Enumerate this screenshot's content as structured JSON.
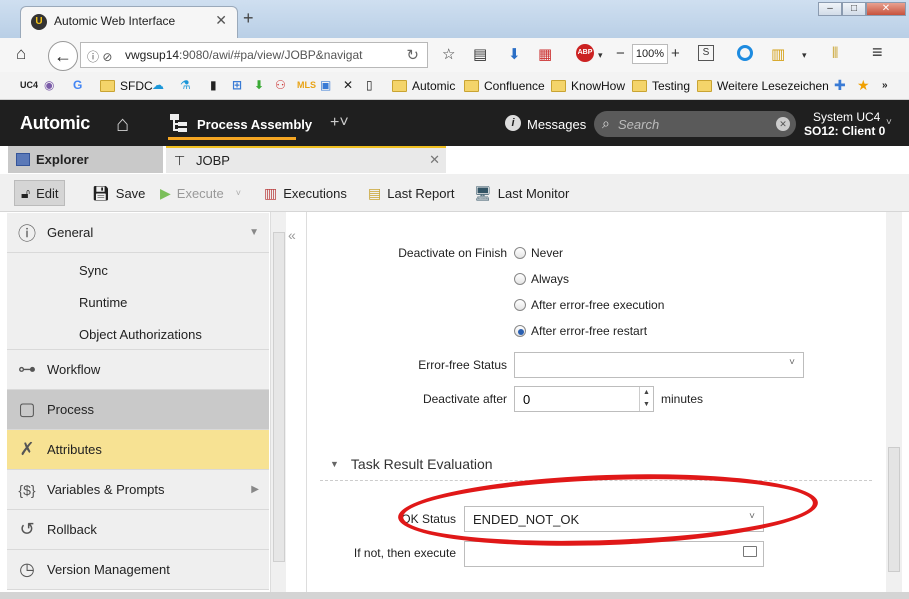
{
  "browser": {
    "tab_title": "Automic Web Interface",
    "url_host": "vwgsup14",
    "url_rest": ":9080/awi/#pa/view/JOBP&navigat",
    "zoom": "100%",
    "bookmarks": [
      "SFDC",
      "Automic",
      "Confluence",
      "KnowHow",
      "Testing",
      "Weitere Lesezeichen"
    ]
  },
  "app": {
    "logo": "Automic",
    "perspective": "Process Assembly",
    "messages": "Messages",
    "search_placeholder": "Search",
    "system": "System UC4",
    "client": "SO12: Client 0"
  },
  "tabs": {
    "explorer": "Explorer",
    "object": "JOBP"
  },
  "toolbar": {
    "edit": "Edit",
    "save": "Save",
    "execute": "Execute",
    "executions": "Executions",
    "last_report": "Last Report",
    "last_monitor": "Last Monitor"
  },
  "sidebar": {
    "general": "General",
    "general_sub": [
      "Sync",
      "Runtime",
      "Object Authorizations"
    ],
    "workflow": "Workflow",
    "process": "Process",
    "attributes": "Attributes",
    "variables": "Variables & Prompts",
    "rollback": "Rollback",
    "version": "Version Management"
  },
  "form": {
    "deactivate_label": "Deactivate on Finish",
    "deactivate_options": [
      "Never",
      "Always",
      "After error-free execution",
      "After error-free restart"
    ],
    "deactivate_selected": 3,
    "errorfree_label": "Error-free Status",
    "errorfree_value": "",
    "deactivate_after_label": "Deactivate after",
    "deactivate_after_value": "0",
    "deactivate_after_unit": "minutes",
    "section_title": "Task Result Evaluation",
    "ok_status_label": "OK Status",
    "ok_status_value": "ENDED_NOT_OK",
    "ifnot_label": "If not, then execute",
    "ifnot_value": ""
  }
}
